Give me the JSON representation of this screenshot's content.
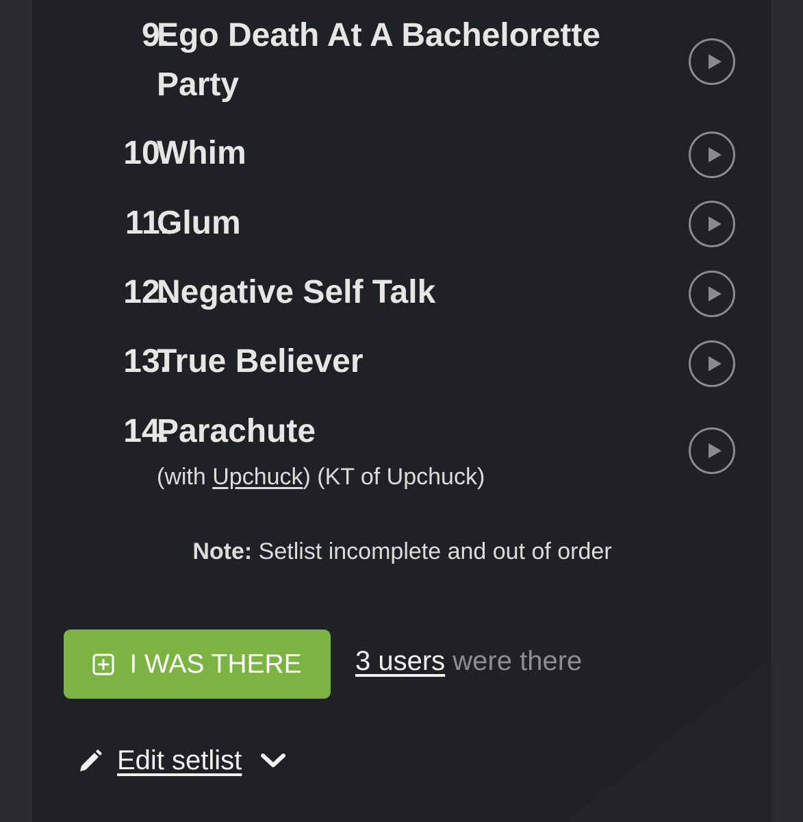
{
  "setlist": {
    "songs": [
      {
        "number": "9.",
        "title": "Ego Death At A Bachelorette Party",
        "info_prefix": "",
        "info_link": "",
        "info_suffix": ""
      },
      {
        "number": "10.",
        "title": "Whim",
        "info_prefix": "",
        "info_link": "",
        "info_suffix": ""
      },
      {
        "number": "11.",
        "title": "Glum",
        "info_prefix": "",
        "info_link": "",
        "info_suffix": ""
      },
      {
        "number": "12.",
        "title": "Negative Self Talk",
        "info_prefix": "",
        "info_link": "",
        "info_suffix": ""
      },
      {
        "number": "13.",
        "title": "True Believer",
        "info_prefix": "",
        "info_link": "",
        "info_suffix": ""
      },
      {
        "number": "14.",
        "title": "Parachute",
        "info_prefix": "(with ",
        "info_link": "Upchuck",
        "info_suffix": ") (KT of Upchuck)"
      }
    ],
    "play_icon": "play-circle-icon"
  },
  "note": {
    "label": "Note:",
    "text": " Setlist incomplete and out of order"
  },
  "attendance": {
    "button_label": "I WAS THERE",
    "button_icon": "plus-square-icon",
    "users_link": "3 users",
    "users_suffix": " were there"
  },
  "edit": {
    "icon": "pencil-icon",
    "label": "Edit setlist",
    "toggle_icon": "chevron-down-icon"
  },
  "colors": {
    "page_background": "#2a2c30",
    "panel_background": "#1f2125",
    "accent_green": "#7cb342",
    "muted_text": "#8d8e91"
  }
}
